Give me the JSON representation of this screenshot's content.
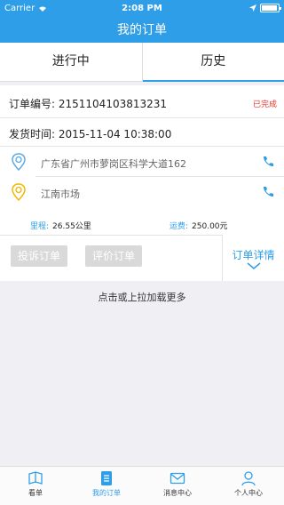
{
  "status_bar": {
    "carrier": "Carrier",
    "time": "2:08 PM",
    "battery_level": 0.95
  },
  "nav": {
    "title": "我的订单"
  },
  "tabs": [
    {
      "label": "进行中",
      "active": false
    },
    {
      "label": "历史",
      "active": true
    }
  ],
  "order": {
    "number_label": "订单编号:",
    "number": "2151104103813231",
    "status": "已完成",
    "ship_time_label": "发货时间:",
    "ship_time": "2015-11-04 10:38:00",
    "from_address": "广东省广州市萝岗区科学大道162",
    "to_address": "江南市场",
    "distance_label": "里程:",
    "distance": "26.55公里",
    "fee_label": "运费:",
    "fee": "250.00元",
    "complain_button": "投诉订单",
    "rate_button": "评价订单",
    "detail_button": "订单详情"
  },
  "load_more": "点击或上拉加载更多",
  "tabbar": [
    {
      "label": "看单",
      "icon": "book-icon",
      "active": false
    },
    {
      "label": "我的订单",
      "icon": "document-icon",
      "active": true
    },
    {
      "label": "消息中心",
      "icon": "mail-icon",
      "active": false
    },
    {
      "label": "个人中心",
      "icon": "person-icon",
      "active": false
    }
  ],
  "colors": {
    "accent": "#2f9ee8",
    "status": "#e8352c",
    "pin_origin": "#5aa9e6",
    "pin_dest": "#f1b700"
  }
}
